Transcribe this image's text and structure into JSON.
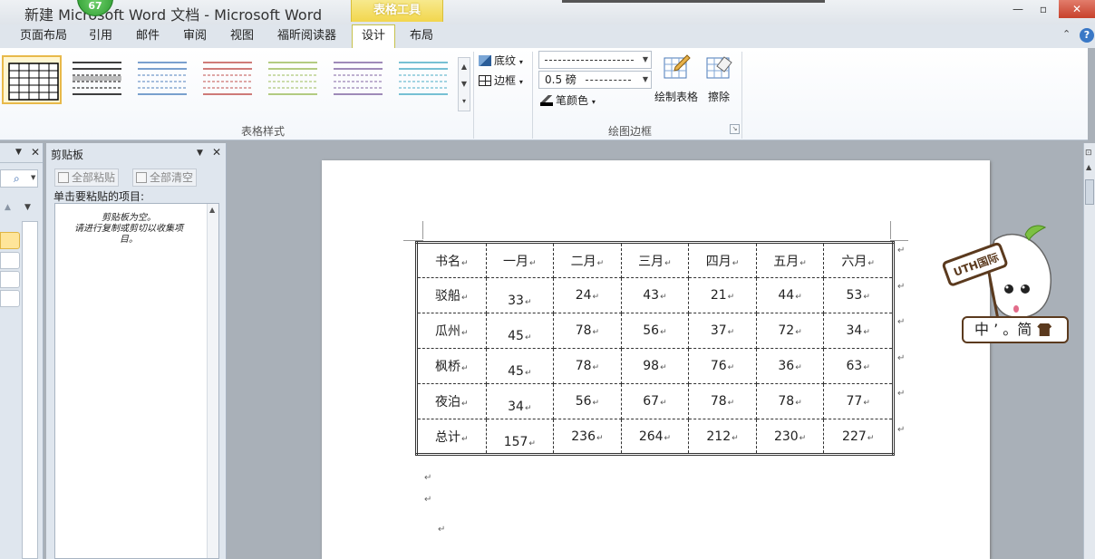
{
  "window": {
    "title": "新建 Microsoft Word 文档 - Microsoft Word",
    "badge": "67",
    "minimize": "—",
    "maximize": "▫",
    "close": "✕"
  },
  "context_tab_header": "表格工具",
  "tabs": [
    {
      "label": "页面布局"
    },
    {
      "label": "引用"
    },
    {
      "label": "邮件"
    },
    {
      "label": "审阅"
    },
    {
      "label": "视图"
    },
    {
      "label": "福昕阅读器"
    },
    {
      "label": "设计",
      "active": true
    },
    {
      "label": "布局"
    }
  ],
  "ribbon": {
    "table_styles_label": "表格样式",
    "shading_label": "底纹",
    "borders_label": "边框",
    "line_weight_value": "0.5 磅",
    "pen_color_label": "笔颜色",
    "draw_table_label": "绘制表格",
    "eraser_label": "擦除",
    "draw_borders_label": "绘图边框",
    "style_colors": [
      "#000000",
      "#000000",
      "#4f81bd",
      "#c0504d",
      "#9bbb59",
      "#8064a2",
      "#4bacc6"
    ]
  },
  "clipboard": {
    "title": "剪贴板",
    "paste_all": "全部粘贴",
    "clear_all": "全部清空",
    "prompt": "单击要粘贴的项目:",
    "empty_line1": "剪贴板为空。",
    "empty_line2": "请进行复制或剪切以收集项",
    "empty_line3": "目。"
  },
  "table": {
    "header": [
      "书名",
      "一月",
      "二月",
      "三月",
      "四月",
      "五月",
      "六月"
    ],
    "rows": [
      [
        "驳船",
        "33",
        "24",
        "43",
        "21",
        "44",
        "53"
      ],
      [
        "瓜州",
        "45",
        "78",
        "56",
        "37",
        "72",
        "34"
      ],
      [
        "枫桥",
        "45",
        "78",
        "98",
        "76",
        "36",
        "63"
      ],
      [
        "夜泊",
        "34",
        "56",
        "67",
        "78",
        "78",
        "77"
      ],
      [
        "总计",
        "157",
        "236",
        "264",
        "212",
        "230",
        "227"
      ]
    ],
    "para_mark": "↵"
  },
  "mascot": {
    "sign_text": "UTH国际",
    "ime_text": "中 ’ 。简"
  }
}
